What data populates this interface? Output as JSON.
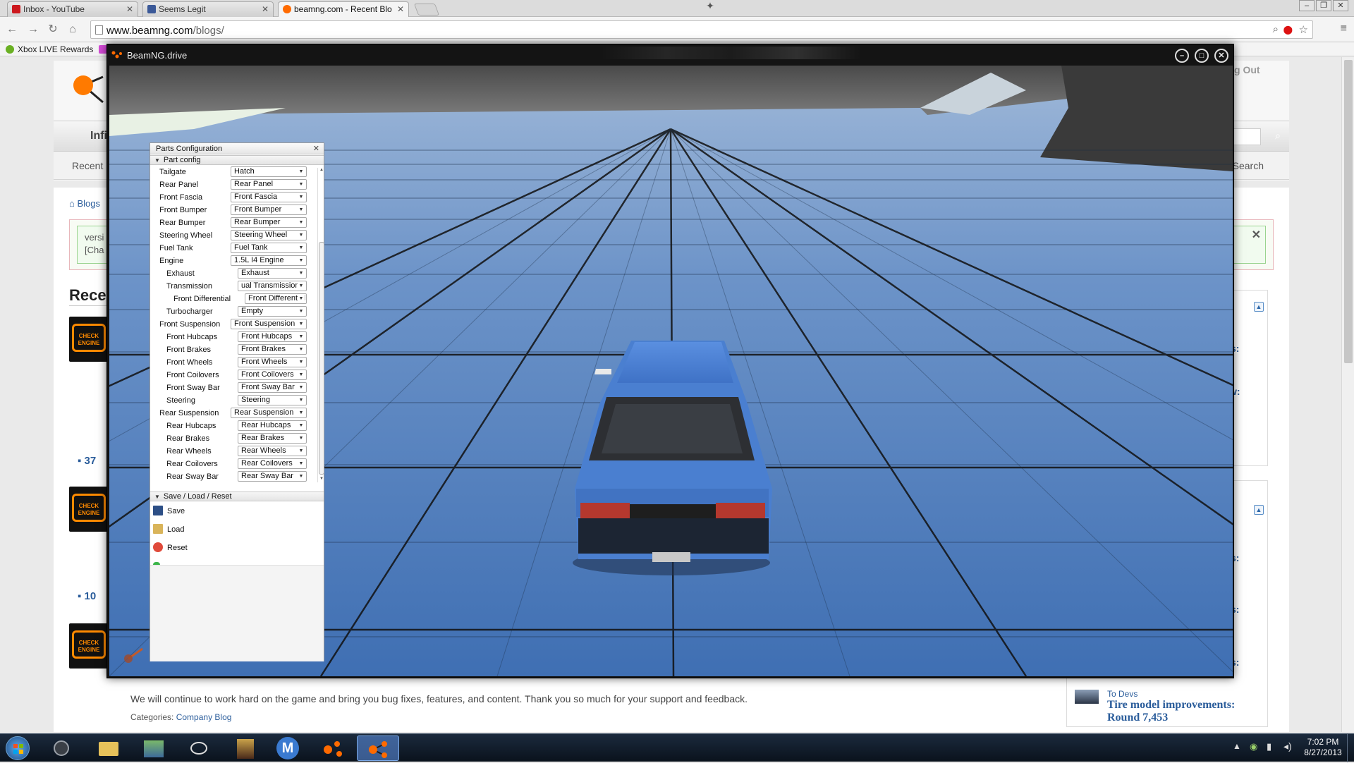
{
  "browser": {
    "tabs": [
      {
        "label": "Inbox - YouTube",
        "icon": "youtube-icon",
        "color": "#cc181e"
      },
      {
        "label": "Seems Legit",
        "icon": "facebook-icon",
        "color": "#3b5998"
      },
      {
        "label": "beamng.com - Recent Blo",
        "icon": "beamng-icon",
        "color": "#ff6a00"
      }
    ],
    "url_host": "www.beamng.com",
    "url_path": "/blogs/",
    "bookmarks": [
      {
        "label": "Xbox LIVE Rewards",
        "icon": "xbox-icon",
        "color": "#6ab023"
      }
    ]
  },
  "webpage": {
    "nav_partial": "Infi",
    "recent_partial": "Recent",
    "search_partial": "d Search",
    "logout_partial": "g Out",
    "breadcrumb": "Blogs",
    "notice_line1": "versi",
    "notice_line2": "[Cha",
    "heading_partial": "Rece",
    "comment_counts": [
      "37",
      "10"
    ],
    "body_text": "We will continue to work hard on the game and bring you bug fixes, features, and content. Thank you so much for your support and feedback.",
    "categories_label": "Categories:",
    "categories_value": "Company Blog",
    "sidebar_fragments": [
      "s:",
      "w:",
      "s:",
      "s:",
      "s:"
    ],
    "sidebar_post": {
      "category": "To Devs",
      "title": "Tire model improvements: Round 7,453"
    }
  },
  "beamng": {
    "window_title": "BeamNG.drive",
    "parts_panel": {
      "title": "Parts Configuration",
      "section_parts": "Part config",
      "section_save": "Save / Load / Reset",
      "rows": [
        {
          "label": "Tailgate",
          "value": "Hatch",
          "indent": 0
        },
        {
          "label": "Rear Panel",
          "value": "Rear Panel",
          "indent": 0
        },
        {
          "label": "Front Fascia",
          "value": "Front Fascia",
          "indent": 0
        },
        {
          "label": "Front Bumper",
          "value": "Front Bumper",
          "indent": 0
        },
        {
          "label": "Rear Bumper",
          "value": "Rear Bumper",
          "indent": 0
        },
        {
          "label": "Steering Wheel",
          "value": "Steering Wheel",
          "indent": 0
        },
        {
          "label": "Fuel Tank",
          "value": "Fuel Tank",
          "indent": 0
        },
        {
          "label": "Engine",
          "value": "1.5L I4 Engine",
          "indent": 0
        },
        {
          "label": "Exhaust",
          "value": "Exhaust",
          "indent": 1
        },
        {
          "label": "Transmission",
          "value": "ual Transmission",
          "indent": 1
        },
        {
          "label": "Front Differential",
          "value": "Front Differential",
          "indent": 2
        },
        {
          "label": "Turbocharger",
          "value": "Empty",
          "indent": 1
        },
        {
          "label": "Front Suspension",
          "value": "Front Suspension",
          "indent": 0
        },
        {
          "label": "Front Hubcaps",
          "value": "Front Hubcaps",
          "indent": 1
        },
        {
          "label": "Front Brakes",
          "value": "Front Brakes",
          "indent": 1
        },
        {
          "label": "Front Wheels",
          "value": "Front Wheels",
          "indent": 1
        },
        {
          "label": "Front Coilovers",
          "value": "Front Coilovers",
          "indent": 1
        },
        {
          "label": "Front Sway Bar",
          "value": "Front Sway Bar",
          "indent": 1
        },
        {
          "label": "Steering",
          "value": "Steering",
          "indent": 1
        },
        {
          "label": "Rear Suspension",
          "value": "Rear Suspension",
          "indent": 0
        },
        {
          "label": "Rear Hubcaps",
          "value": "Rear Hubcaps",
          "indent": 1
        },
        {
          "label": "Rear Brakes",
          "value": "Rear Brakes",
          "indent": 1
        },
        {
          "label": "Rear Wheels",
          "value": "Rear Wheels",
          "indent": 1
        },
        {
          "label": "Rear Coilovers",
          "value": "Rear Coilovers",
          "indent": 1
        },
        {
          "label": "Rear Sway Bar",
          "value": "Rear Sway Bar",
          "indent": 1
        }
      ],
      "actions": [
        {
          "label": "Save",
          "icon": "floppy-icon"
        },
        {
          "label": "Load",
          "icon": "folder-icon"
        },
        {
          "label": "Reset",
          "icon": "reset-icon"
        }
      ]
    }
  },
  "taskbar": {
    "time": "7:02 PM",
    "date": "8/27/2013"
  },
  "colors": {
    "grid_floor": "#4a78b8",
    "car_body": "#4a7fd0",
    "accent_orange": "#ff6a00",
    "link_blue": "#2b5d9b"
  }
}
